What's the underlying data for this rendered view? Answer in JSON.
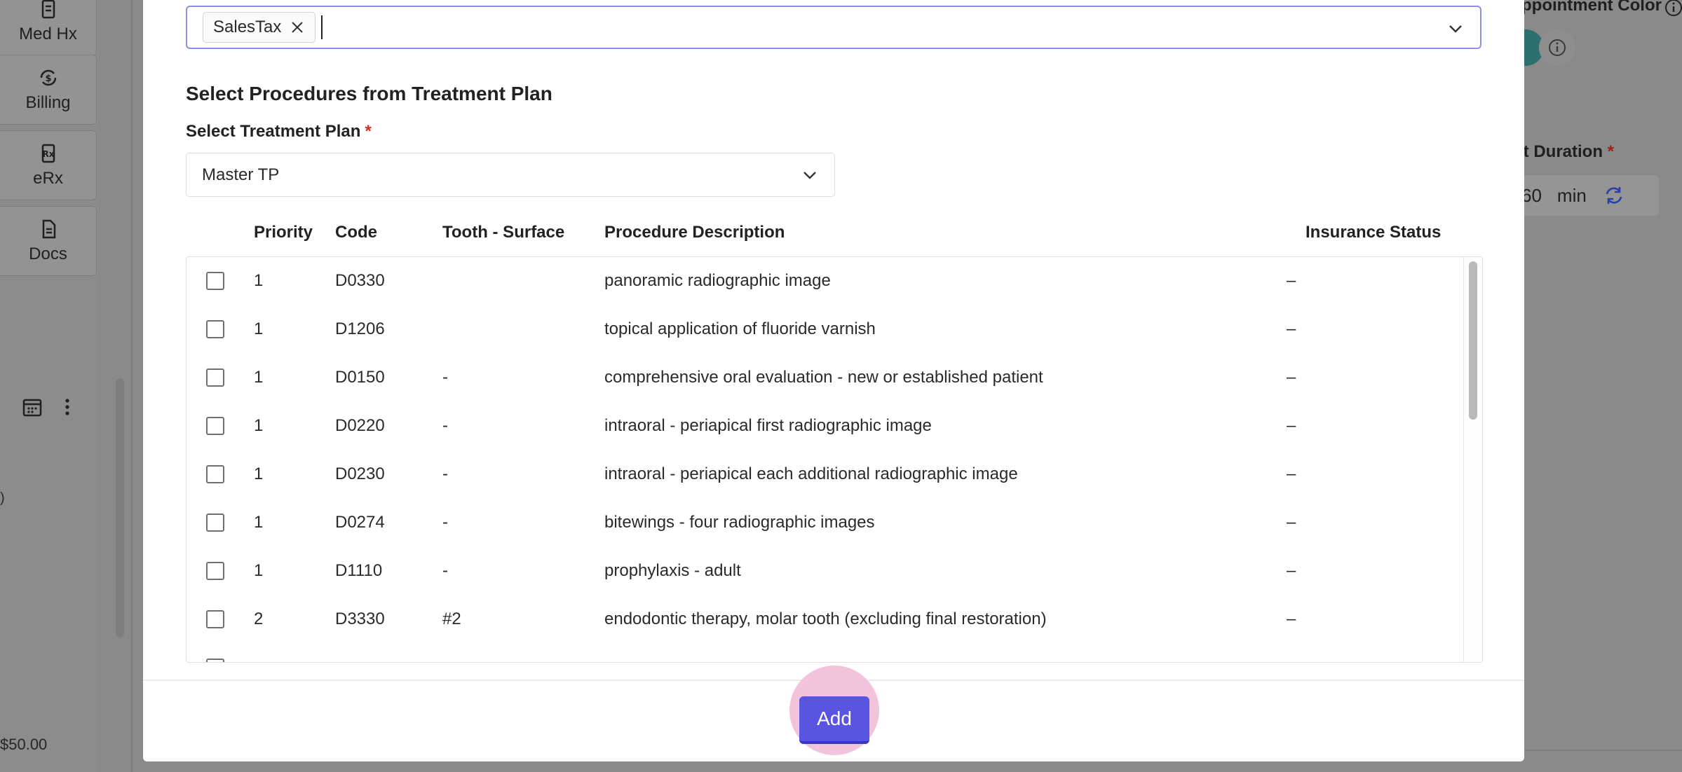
{
  "background": {
    "sidebar_items": [
      {
        "label": "Med Hx",
        "icon": "document-icon"
      },
      {
        "label": "Billing",
        "icon": "billing-icon"
      },
      {
        "label": "eRx",
        "icon": "prescription-icon"
      },
      {
        "label": "Docs",
        "icon": "docs-icon"
      }
    ],
    "amount_text": "$50.00",
    "mid_caption": ")",
    "appointment_color_label": "ppointment Color",
    "appt_duration_label": "pt Duration",
    "appt_duration_required": "*",
    "duration_value": "60",
    "duration_unit": "min"
  },
  "modal": {
    "tags": [
      {
        "label": "SalesTax"
      }
    ],
    "section_title": "Select Procedures from Treatment Plan",
    "treatment_plan": {
      "label": "Select Treatment Plan",
      "required": "*",
      "value": "Master TP"
    },
    "table": {
      "columns": {
        "priority": "Priority",
        "code": "Code",
        "tooth_surface": "Tooth - Surface",
        "description": "Procedure Description",
        "insurance_status": "Insurance Status"
      },
      "rows": [
        {
          "priority": "1",
          "code": "D0330",
          "tooth": "",
          "description": "panoramic radiographic image",
          "status": "–"
        },
        {
          "priority": "1",
          "code": "D1206",
          "tooth": "",
          "description": "topical application of fluoride varnish",
          "status": "–"
        },
        {
          "priority": "1",
          "code": "D0150",
          "tooth": "-",
          "description": "comprehensive oral evaluation - new or established patient",
          "status": "–"
        },
        {
          "priority": "1",
          "code": "D0220",
          "tooth": "-",
          "description": "intraoral - periapical first radiographic image",
          "status": "–"
        },
        {
          "priority": "1",
          "code": "D0230",
          "tooth": "-",
          "description": "intraoral - periapical each additional radiographic image",
          "status": "–"
        },
        {
          "priority": "1",
          "code": "D0274",
          "tooth": "-",
          "description": "bitewings - four radiographic images",
          "status": "–"
        },
        {
          "priority": "1",
          "code": "D1110",
          "tooth": "-",
          "description": "prophylaxis - adult",
          "status": "–"
        },
        {
          "priority": "2",
          "code": "D3330",
          "tooth": "#2",
          "description": "endodontic therapy, molar tooth (excluding final restoration)",
          "status": "–"
        }
      ]
    },
    "add_button_label": "Add"
  },
  "colors": {
    "accent": "#5a55e0",
    "focus_border": "#8e90e4",
    "required": "#d12d2d",
    "click_halo": "#f2c4dc"
  }
}
